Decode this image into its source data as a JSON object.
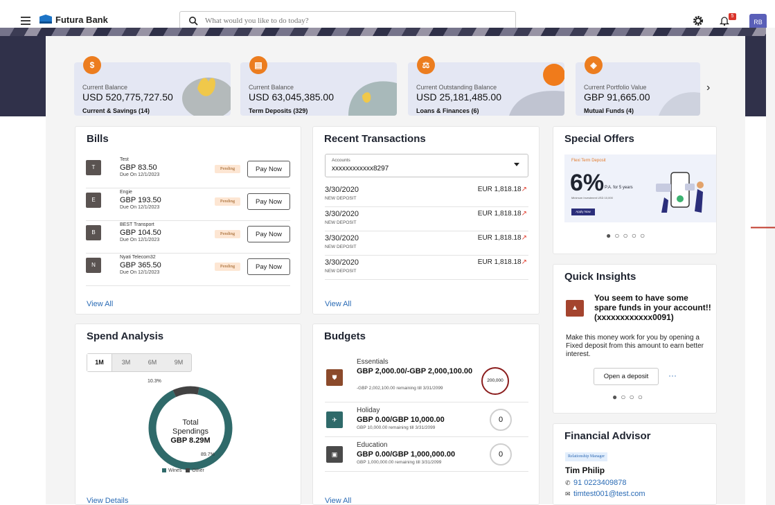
{
  "app": {
    "brand": "Futura Bank",
    "avatar_initials": "RB",
    "notification_count": "5"
  },
  "search": {
    "placeholder": "What would you like to do today?"
  },
  "summary": [
    {
      "label": "Current Balance",
      "value": "USD 520,775,727.50",
      "sub": "Current & Savings (14)",
      "icon": "dollar-icon",
      "icon_glyph": "$"
    },
    {
      "label": "Current Balance",
      "value": "USD 63,045,385.00",
      "sub": "Term Deposits (329)",
      "icon": "deposit-icon",
      "icon_glyph": "▤"
    },
    {
      "label": "Current Outstanding Balance",
      "value": "USD 25,181,485.00",
      "sub": "Loans & Finances (6)",
      "icon": "loan-icon",
      "icon_glyph": "⚖"
    },
    {
      "label": "Current Portfolio Value",
      "value": "GBP 91,665.00",
      "sub": "Mutual Funds (4)",
      "icon": "fund-icon",
      "icon_glyph": "◈"
    }
  ],
  "bills": {
    "title": "Bills",
    "items": [
      {
        "initial": "T",
        "name": "Test",
        "amount": "GBP 83.50",
        "due": "Due On 12/1/2023",
        "status": "Pending",
        "action": "Pay Now"
      },
      {
        "initial": "E",
        "name": "Engie",
        "amount": "GBP 193.50",
        "due": "Due On 12/1/2023",
        "status": "Pending",
        "action": "Pay Now"
      },
      {
        "initial": "B",
        "name": "BEST Transport",
        "amount": "GBP 104.50",
        "due": "Due On 12/1/2023",
        "status": "Pending",
        "action": "Pay Now"
      },
      {
        "initial": "N",
        "name": "Nyati Telecom32",
        "amount": "GBP 365.50",
        "due": "Due On 12/1/2023",
        "status": "Pending",
        "action": "Pay Now"
      }
    ],
    "view_all": "View All"
  },
  "transactions": {
    "title": "Recent Transactions",
    "account_label": "Accounts",
    "account_value": "xxxxxxxxxxxx8297",
    "items": [
      {
        "date": "3/30/2020",
        "type": "NEW DEPOSIT",
        "amount": "EUR 1,818.18"
      },
      {
        "date": "3/30/2020",
        "type": "NEW DEPOSIT",
        "amount": "EUR 1,818.18"
      },
      {
        "date": "3/30/2020",
        "type": "NEW DEPOSIT",
        "amount": "EUR 1,818.18"
      },
      {
        "date": "3/30/2020",
        "type": "NEW DEPOSIT",
        "amount": "EUR 1,818.18"
      }
    ],
    "view_all": "View All"
  },
  "spend": {
    "title": "Spend Analysis",
    "tabs": [
      "1M",
      "3M",
      "6M",
      "9M"
    ],
    "active_tab": "1M",
    "center_label_1": "Total",
    "center_label_2": "Spendings",
    "center_value": "GBP 8.29M",
    "slices": [
      {
        "name": "Wines",
        "percent": 10.3,
        "label": "10.3%",
        "color": "#424242"
      },
      {
        "name": "Other",
        "percent": 89.7,
        "label": "89.7%",
        "color": "#2f6a6a"
      }
    ],
    "view_details": "View Details"
  },
  "budgets": {
    "title": "Budgets",
    "items": [
      {
        "name": "Essentials",
        "amount": "GBP 2,000.00/-GBP 2,000,100.00",
        "remaining": "-GBP 2,002,100.00 remaining till 3/31/2099",
        "ring": "200,000",
        "color": "#8b4a2b",
        "ring_color": "#8b1d1d"
      },
      {
        "name": "Holiday",
        "amount": "GBP 0.00/GBP 10,000.00",
        "remaining": "GBP 10,000.00 remaining till 3/31/2099",
        "ring": "0",
        "color": "#2f6a6a",
        "ring_color": "#cfcfcf"
      },
      {
        "name": "Education",
        "amount": "GBP 0.00/GBP 1,000,000.00",
        "remaining": "GBP 1,000,000.00 remaining till 3/31/2099",
        "ring": "0",
        "color": "#4a4a4a",
        "ring_color": "#cfcfcf"
      }
    ],
    "view_all": "View All"
  },
  "offers": {
    "title": "Special Offers",
    "promo_tag": "Flexi Term Deposit",
    "promo_rate": "6%",
    "promo_suffix": "P.A. for 5 years",
    "promo_min": "Minimum Investment USD 10,000",
    "promo_cta": "Apply Now",
    "dots": "●○○○○"
  },
  "insights": {
    "title": "Quick Insights",
    "headline": "You seem to have some spare funds in your account!! (xxxxxxxxxxxx0091)",
    "body": "Make this money work for you by opening a Fixed deposit from this amount to earn better interest.",
    "action": "Open a deposit",
    "more": "···",
    "dots": "●○○○"
  },
  "advisor": {
    "title": "Financial Advisor",
    "role": "Relationship Manager",
    "name": "Tim Philip",
    "phone": "91 0223409878",
    "email": "timtest001@test.com"
  },
  "colors": {
    "accent": "#ec7d1f",
    "link": "#2a6bb5",
    "banner": "#30314a",
    "card_bg": "#e4e7f3"
  }
}
